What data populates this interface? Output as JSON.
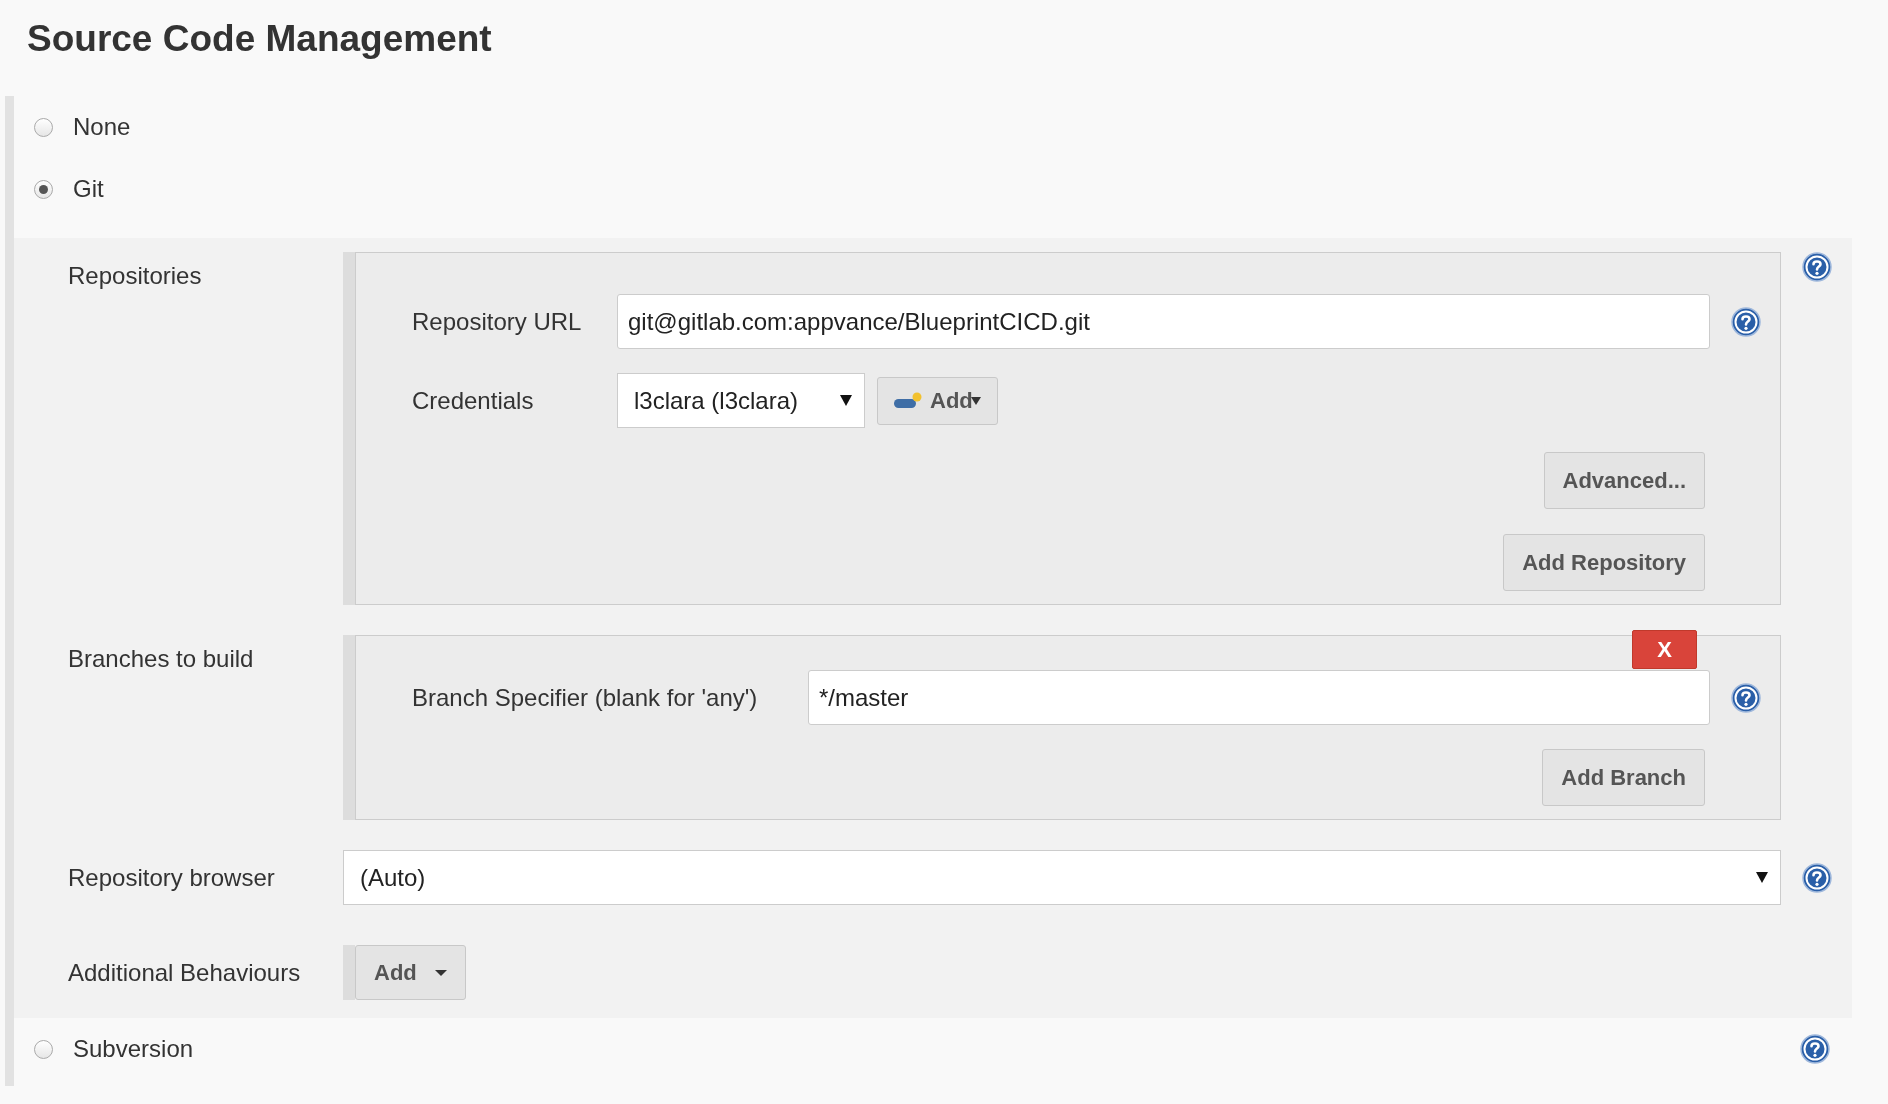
{
  "title": "Source Code Management",
  "options": [
    {
      "label": "None",
      "selected": false
    },
    {
      "label": "Git",
      "selected": true,
      "config": {
        "repositories": {
          "label": "Repositories",
          "url": {
            "label": "Repository URL",
            "value": "git@gitlab.com:appvance/BlueprintCICD.git"
          },
          "credentials": {
            "label": "Credentials",
            "value": "l3clara (l3clara)",
            "add_button": "Add"
          },
          "buttons": [
            "Advanced...",
            "Add Repository"
          ]
        },
        "branches": {
          "label": "Branches to build",
          "delete_button": "X",
          "specifier": {
            "label": "Branch Specifier (blank for 'any')",
            "value": "*/master"
          },
          "add_button": "Add Branch"
        },
        "repository_browser": {
          "label": "Repository browser",
          "value": "(Auto)"
        },
        "additional_behaviours": {
          "label": "Additional Behaviours",
          "add_button": "Add"
        }
      }
    },
    {
      "label": "Subversion",
      "selected": false,
      "help": true
    }
  ]
}
